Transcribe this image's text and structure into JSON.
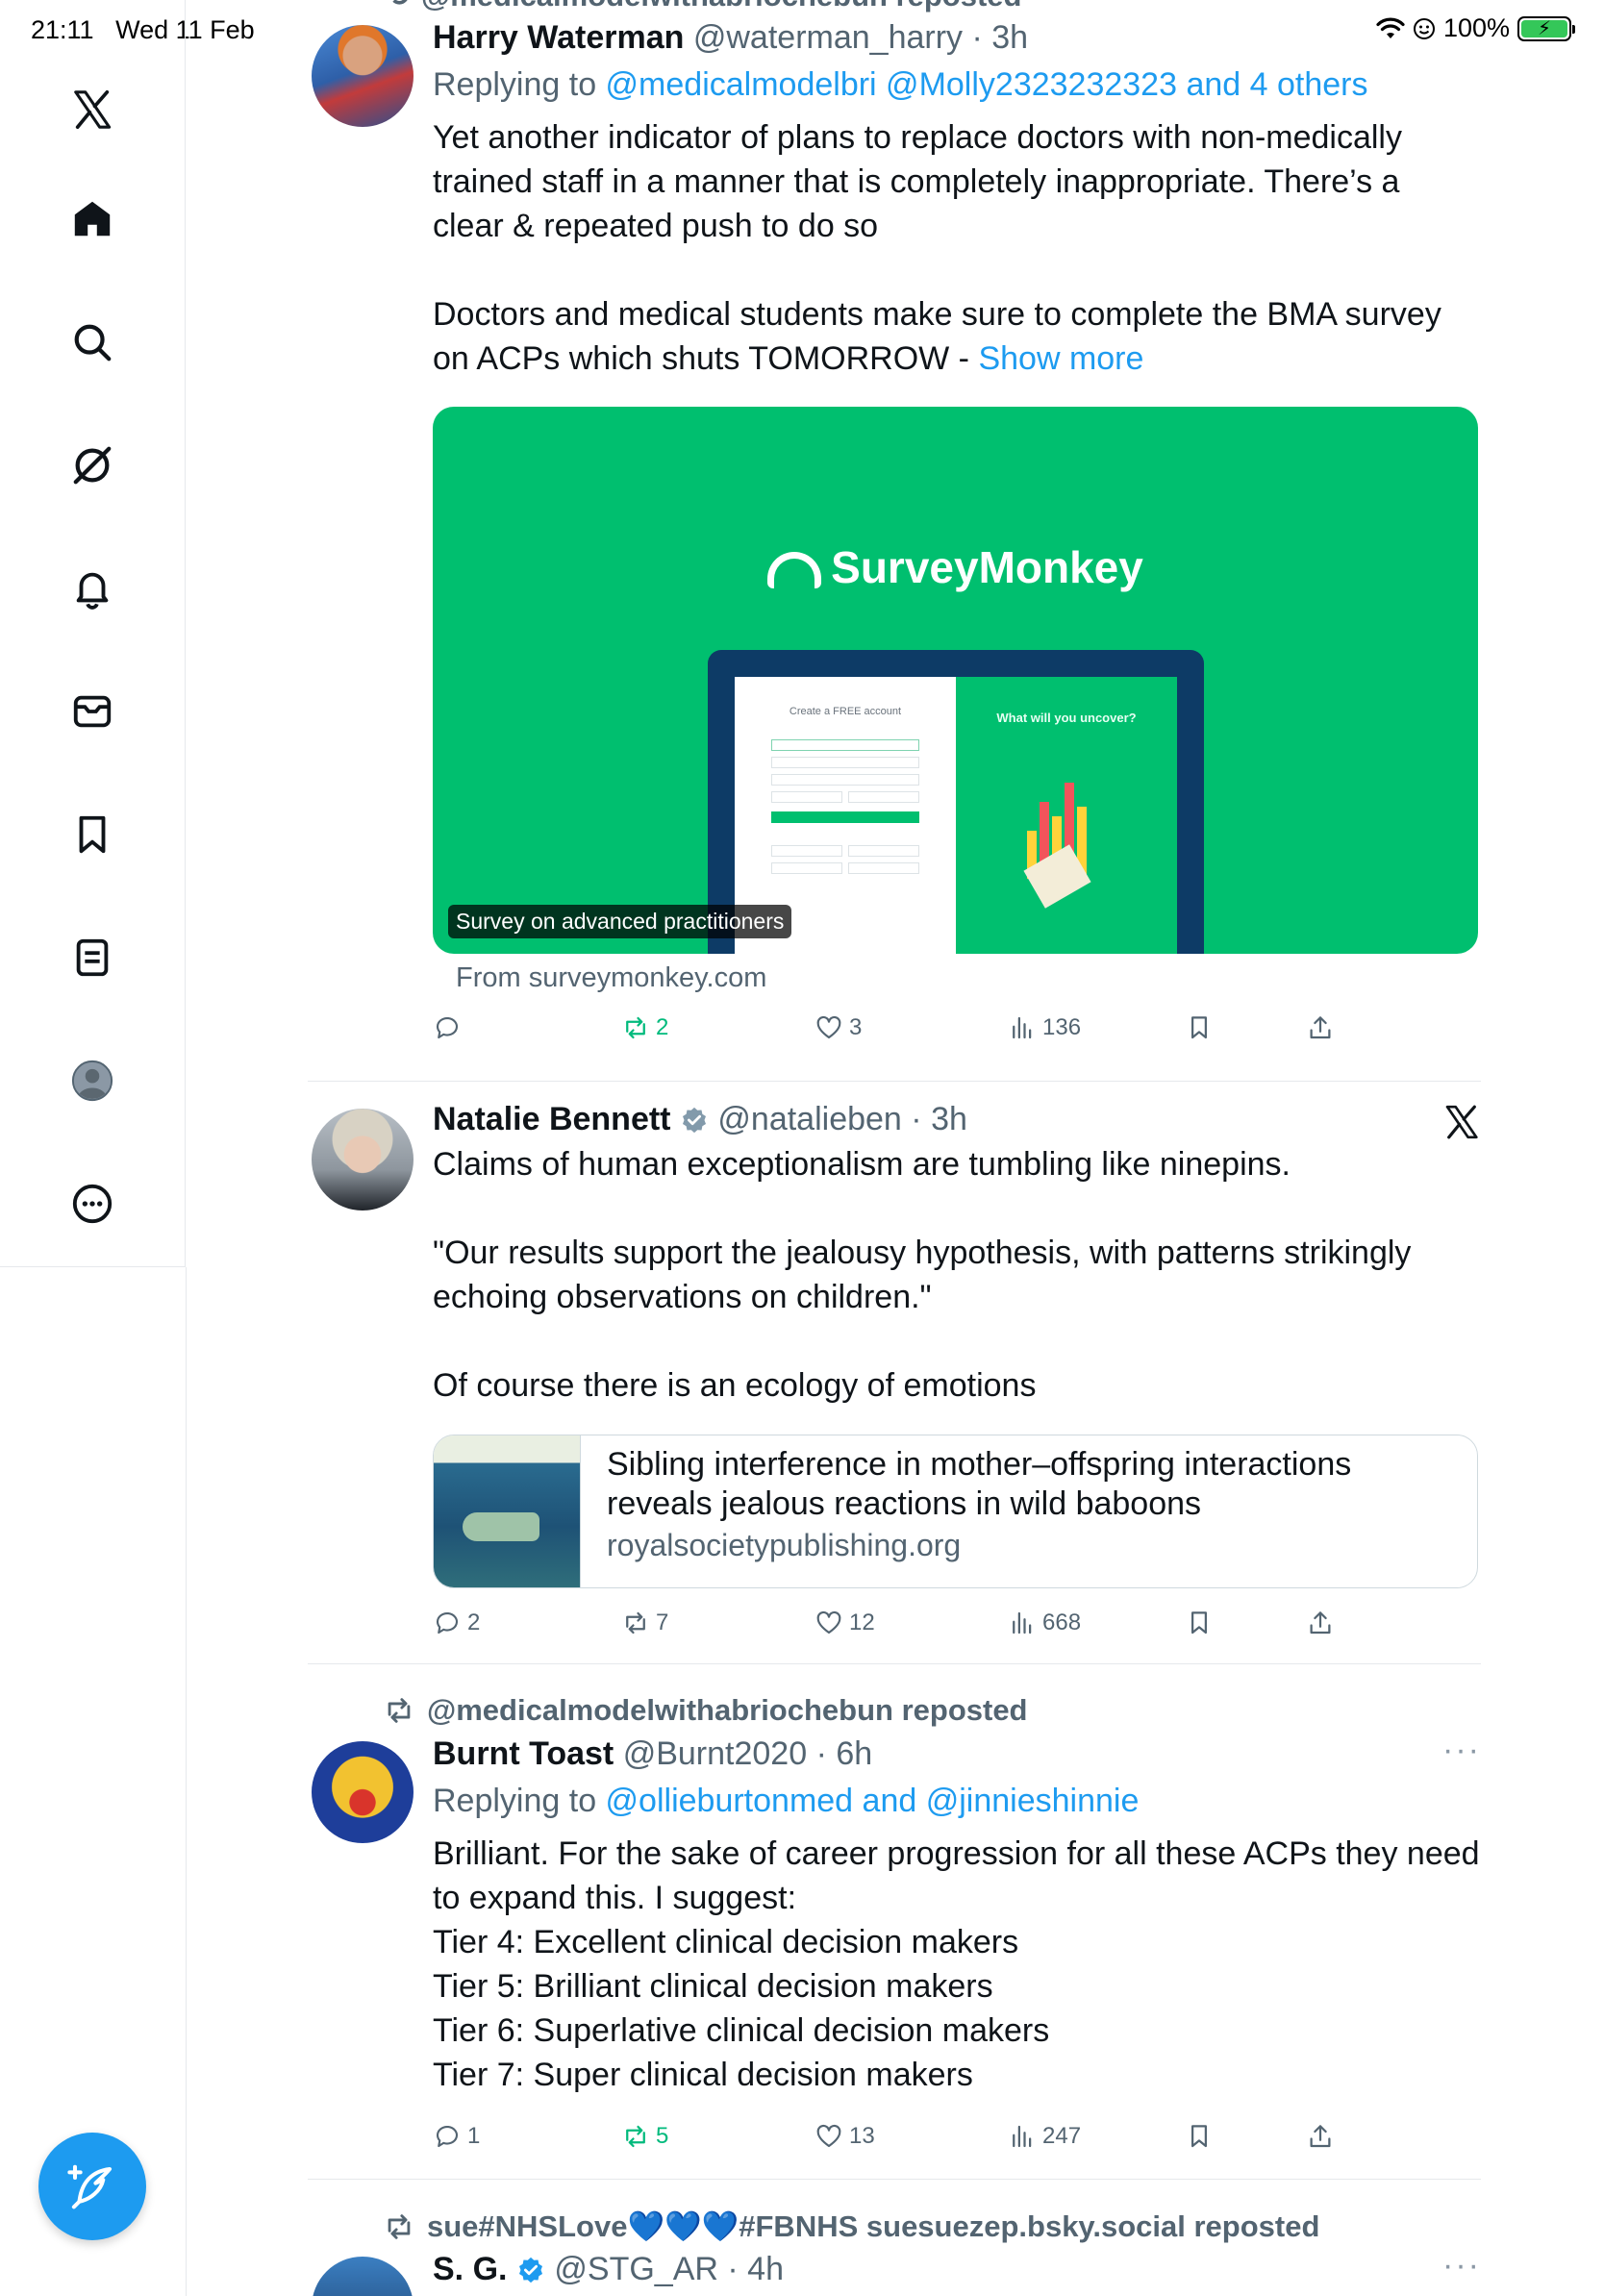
{
  "status_bar": {
    "time": "21:11",
    "date": "Wed 11 Feb",
    "battery": "100%"
  },
  "sidebar": {
    "items": [
      "x-logo",
      "home",
      "search",
      "grok",
      "notifications",
      "messages",
      "bookmarks",
      "lists",
      "profile",
      "more"
    ]
  },
  "top_partial_repost": "@medicalmodelwithabriochebun reposted",
  "tweets": [
    {
      "name": "Harry Waterman",
      "handle": "@waterman_harry",
      "time": "3h",
      "replying_label": "Replying to ",
      "replying_to": "@medicalmodelbri @Molly2323232323 and 4 others",
      "body": [
        "Yet another indicator of plans to replace doctors with non-medically",
        "trained staff in a manner that is completely inappropriate. There’s a",
        "clear & repeated push to do so",
        "",
        "Doctors and medical students make sure to complete the BMA survey",
        "on ACPs which shuts TOMORROW  - "
      ],
      "show_more": "Show more",
      "card": {
        "brand": "SurveyMonkey",
        "badge": "Survey on advanced practitioners",
        "screen_left_title": "Create a FREE account",
        "screen_right_title": "What will you uncover?",
        "from": "From surveymonkey.com"
      },
      "stats": {
        "replies": "",
        "reposts": "2",
        "likes": "3",
        "views": "136"
      }
    },
    {
      "name": "Natalie Bennett",
      "handle": "@natalieben",
      "time": "3h",
      "body": [
        "Claims of human exceptionalism are tumbling like ninepins.",
        "",
        "\"Our results support the jealousy hypothesis, with patterns strikingly",
        "echoing observations on children.\"",
        "",
        "Of course there is an ecology of emotions"
      ],
      "link_card": {
        "title_lines": [
          "Sibling interference in mother–offspring interactions",
          "reveals jealous reactions in wild baboons"
        ],
        "domain": "royalsocietypublishing.org"
      },
      "stats": {
        "replies": "2",
        "reposts": "7",
        "likes": "12",
        "views": "668"
      }
    },
    {
      "reposted_by": "@medicalmodelwithabriochebun reposted",
      "name": "Burnt Toast",
      "handle": "@Burnt2020",
      "time": "6h",
      "replying_label": "Replying to ",
      "replying_to": "@ollieburtonmed and @jinnieshinnie",
      "body": [
        "Brilliant. For the sake of career progression for all these ACPs they need",
        "to expand this. I suggest:",
        "Tier 4: Excellent clinical decision makers",
        "Tier 5: Brilliant clinical decision makers",
        "Tier 6: Superlative clinical decision makers",
        "Tier 7: Super clinical decision makers"
      ],
      "stats": {
        "replies": "1",
        "reposts": "5",
        "likes": "13",
        "views": "247"
      }
    },
    {
      "reposted_by": "sue#NHSLove💙💙💙#FBNHS suesuezep.bsky.social reposted",
      "name": "S. G.",
      "handle": "@STG_AR",
      "time": "4h"
    }
  ],
  "colors": {
    "accent": "#1d9bf0",
    "repost_green": "#00ba7c",
    "survey_green": "#00bf6f",
    "muted": "#536471"
  }
}
